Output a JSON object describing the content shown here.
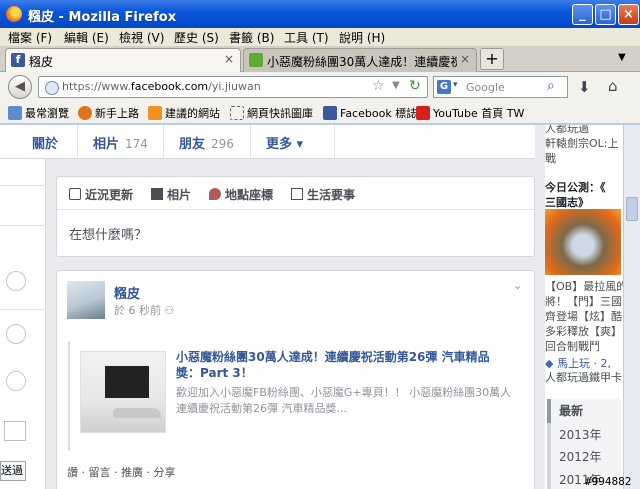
{
  "window": {
    "title": "糨皮 - Mozilla Firefox",
    "min": "_",
    "max": "□",
    "close": "×"
  },
  "menu": [
    "檔案 (F)",
    "編輯 (E)",
    "檢視 (V)",
    "歷史 (S)",
    "書籤 (B)",
    "工具 (T)",
    "說明 (H)"
  ],
  "tabs": [
    {
      "label": "糨皮",
      "close": "×",
      "icon": "facebook-icon",
      "active": true
    },
    {
      "label": "小惡魔粉絲團30萬人達成！連續慶祝…",
      "close": "×",
      "icon": "page-icon",
      "active": false
    }
  ],
  "newtab": "+",
  "nav": {
    "url_prefix": "https://www.",
    "url_domain": "facebook.com",
    "url_path": "/yi.jiuwan",
    "search_placeholder": "Google",
    "search_engine": "G"
  },
  "bookmarks": [
    {
      "label": "最常瀏覽",
      "color": "#5b8bd0"
    },
    {
      "label": "新手上路",
      "color": "#e2741a"
    },
    {
      "label": "建議的網站",
      "color": "#f09020"
    },
    {
      "label": "網頁快訊圖庫",
      "color": "#ffffff"
    },
    {
      "label": "Facebook 標誌",
      "color": "#3b5998"
    },
    {
      "label": "YouTube 首頁 TW",
      "color": "#d62020"
    }
  ],
  "profile_nav": {
    "about": "關於",
    "photos": "相片",
    "photos_count": "174",
    "friends": "朋友",
    "friends_count": "296",
    "more": "更多 ▾"
  },
  "composer": {
    "tab_status": "近況更新",
    "tab_photo": "相片",
    "tab_place": "地點座標",
    "tab_event": "生活要事",
    "placeholder": "在想什麼嗎？"
  },
  "post": {
    "author": "糨皮",
    "time": "於 6 秒前",
    "link_title": "小惡魔粉絲團30萬人達成！連續慶祝活動第26彈 汽車精品獎：Part 3！",
    "link_desc": "歡迎加入小惡魔FB粉絲團、小惡魔G+專頁！！ 小惡魔粉絲團30萬人連續慶祝活動第26彈 汽車精品獎...",
    "actions": "讚 · 留言 · 推廣 · 分享"
  },
  "sidebar": {
    "top_text1": "人都玩過",
    "top_text2": "軒轅劍宗OL:上",
    "top_text3": "戰",
    "heading1": "今日公測：《",
    "heading2": "三國志》",
    "ad_text1": "【OB】最拉風的",
    "ad_text2": "將！【門】三國",
    "ad_text3": "齊登場【炫】酷",
    "ad_text4": "多彩釋放【爽】",
    "ad_text5": "回合制戰鬥",
    "play_link": "馬上玩 · 2,",
    "play_sub": "人都玩過鐵甲卡",
    "years": [
      "最新",
      "2013年",
      "2012年",
      "2011年"
    ]
  },
  "leftcol": {
    "button_label": "送過"
  },
  "watermark": "#994882"
}
